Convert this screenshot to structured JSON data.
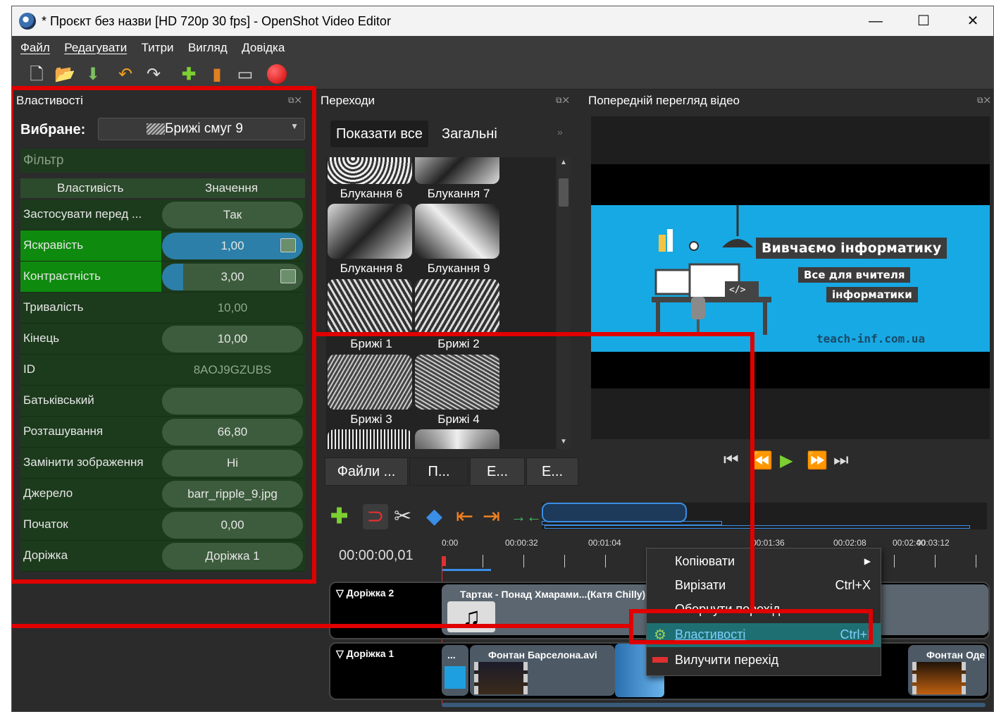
{
  "window": {
    "title": "* Проєкт без назви [HD 720p 30 fps] - OpenShot Video Editor",
    "controls": [
      "—",
      "☐",
      "✕"
    ]
  },
  "menu": [
    "Файл",
    "Редагувати",
    "Титри",
    "Вигляд",
    "Довідка"
  ],
  "properties": {
    "panel_title": "Властивості",
    "selected_label": "Вибране:",
    "selected_value": "Брижі смуг 9",
    "filter_placeholder": "Фільтр",
    "col_property": "Властивість",
    "col_value": "Значення",
    "rows": [
      {
        "name": "Застосувати перед ...",
        "value": "Так",
        "kind": "pill"
      },
      {
        "name": "Яскравість",
        "value": "1,00",
        "kind": "slider",
        "fill": 1.0,
        "highlight": true
      },
      {
        "name": "Контрастність",
        "value": "3,00",
        "kind": "slider",
        "fill": 0.15,
        "highlight": true
      },
      {
        "name": "Тривалість",
        "value": "10,00",
        "kind": "plain"
      },
      {
        "name": "Кінець",
        "value": "10,00",
        "kind": "pill"
      },
      {
        "name": "ID",
        "value": "8AOJ9GZUBS",
        "kind": "plain"
      },
      {
        "name": "Батьківський",
        "value": "",
        "kind": "pill"
      },
      {
        "name": "Розташування",
        "value": "66,80",
        "kind": "pill"
      },
      {
        "name": "Замінити зображення",
        "value": "Ні",
        "kind": "pill"
      },
      {
        "name": "Джерело",
        "value": "barr_ripple_9.jpg",
        "kind": "pill"
      },
      {
        "name": "Початок",
        "value": "0,00",
        "kind": "pill"
      },
      {
        "name": "Доріжка",
        "value": "Доріжка 1",
        "kind": "pill"
      }
    ]
  },
  "transitions": {
    "panel_title": "Переходи",
    "tab_all": "Показати все",
    "tab_common": "Загальні",
    "items": [
      "Блукання 6",
      "Блукання 7",
      "Блукання 8",
      "Блукання 9",
      "Брижі 1",
      "Брижі 2",
      "Брижі 3",
      "Брижі 4"
    ]
  },
  "bottom_tabs": [
    "Файли ...",
    "П...",
    "Е...",
    "Е..."
  ],
  "preview": {
    "panel_title": "Попередній перегляд відео",
    "slide_title": "Вивчаємо інформатику",
    "slide_line2": "Все для вчителя",
    "slide_line3": "інформатики",
    "slide_url": "teach-inf.com.ua"
  },
  "timeline": {
    "current_time": "00:00:00,01",
    "ticks": [
      "0:00",
      "00:00:32",
      "00:01:04",
      "00:01:36",
      "00:02:08",
      "00:02:40",
      "00:03:12"
    ],
    "track2": {
      "name": "Доріжка 2",
      "clip": "Тартак - Понад Хмарами...(Катя Chilly)"
    },
    "track1": {
      "name": "Доріжка 1",
      "clip_a": "...",
      "clip_b": "Фонтан Барселона.avi",
      "clip_c": "Фонтан Оде"
    }
  },
  "context_menu": {
    "items": [
      {
        "label": "Копіювати",
        "shortcut": "",
        "submenu": true
      },
      {
        "label": "Вирізати",
        "shortcut": "Ctrl+X"
      },
      {
        "label": "Обернути перехід",
        "shortcut": ""
      },
      {
        "label": "Властивості",
        "shortcut": "Ctrl+I",
        "selected": true
      },
      {
        "label": "Вилучити перехід",
        "shortcut": ""
      }
    ]
  },
  "colors": {
    "highlight_box": "#e00000",
    "property_row": "#1c3a1c",
    "property_highlight": "#0e8a0e",
    "menu_selected": "#1e6f72"
  }
}
